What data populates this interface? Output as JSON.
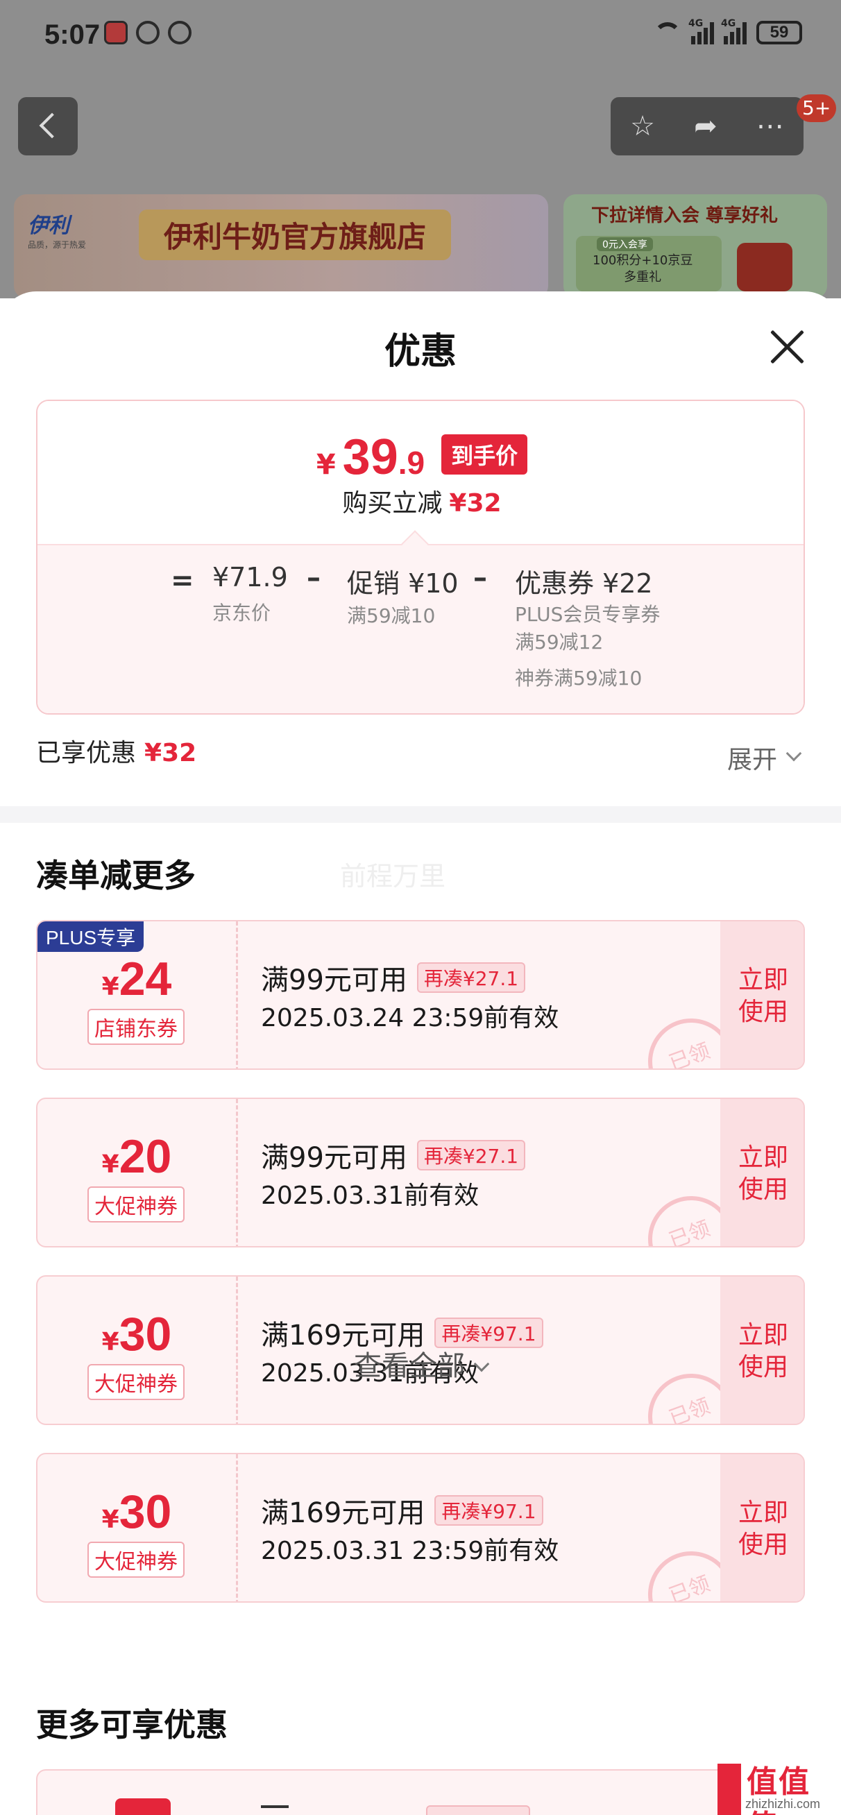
{
  "status": {
    "time": "5:07",
    "net1": "4G",
    "net2": "4G",
    "battery": "59"
  },
  "nav": {
    "badge": "5+",
    "icons": [
      "back-icon",
      "star-icon",
      "share-icon",
      "more-icon"
    ]
  },
  "background": {
    "store_logo": "伊利",
    "store_logo_sub": "品质，源于热爱",
    "store_name": "伊利牛奶官方旗舰店",
    "promo_title": "下拉详情入会 尊享好礼",
    "promo_tag": "0元入会享",
    "promo_line1": "100积分+10京豆",
    "promo_line2": "多重礼"
  },
  "sheet": {
    "title": "优惠",
    "final_price": {
      "yen": "¥",
      "int": "39",
      "dec": ".9",
      "tag": "到手价"
    },
    "save_label": "购买立减",
    "save_amount": "¥32",
    "breakdown": {
      "eq": "=",
      "jd_price": "¥71.9",
      "jd_price_label": "京东价",
      "minus": "–",
      "promo": "促销 ¥10",
      "promo_sub": "满59减10",
      "coupon": "优惠券 ¥22",
      "coupon_sub1": "PLUS会员专享券",
      "coupon_sub2": "满59减12",
      "coupon_sub3": "神券满59减10"
    },
    "enjoyed_label": "已享优惠",
    "enjoyed_amount": "¥32",
    "expand_label": "展开",
    "section1_title": "凑单减更多",
    "watermark": "前程万里",
    "coupons": [
      {
        "plus": "PLUS专享",
        "yen": "¥",
        "amount": "24",
        "type": "店铺东券",
        "cond": "满99元可用",
        "more": "再凑¥27.1",
        "date": "2025.03.24 23:59前有效",
        "stamp": "已领",
        "btn1": "立即",
        "btn2": "使用"
      },
      {
        "plus": "",
        "yen": "¥",
        "amount": "20",
        "type": "大促神券",
        "cond": "满99元可用",
        "more": "再凑¥27.1",
        "date": "2025.03.31前有效",
        "stamp": "已领",
        "btn1": "立即",
        "btn2": "使用"
      },
      {
        "plus": "",
        "yen": "¥",
        "amount": "30",
        "type": "大促神券",
        "cond": "满169元可用",
        "more": "再凑¥97.1",
        "date": "2025.03.31前有效",
        "stamp": "已领",
        "btn1": "立即",
        "btn2": "使用"
      },
      {
        "plus": "",
        "yen": "¥",
        "amount": "30",
        "type": "大促神券",
        "cond": "满169元可用",
        "more": "再凑¥97.1",
        "date": "2025.03.31 23:59前有效",
        "stamp": "已领",
        "btn1": "立即",
        "btn2": "使用"
      }
    ],
    "view_all": "查看全部",
    "section2_title": "更多可享优惠"
  },
  "site_badge": {
    "logo": "值值值",
    "url": "zhizhizhi.com"
  },
  "colors": {
    "accent": "#e4253a",
    "plus": "#2c3d95",
    "coupon_bg": "#fef3f4"
  }
}
